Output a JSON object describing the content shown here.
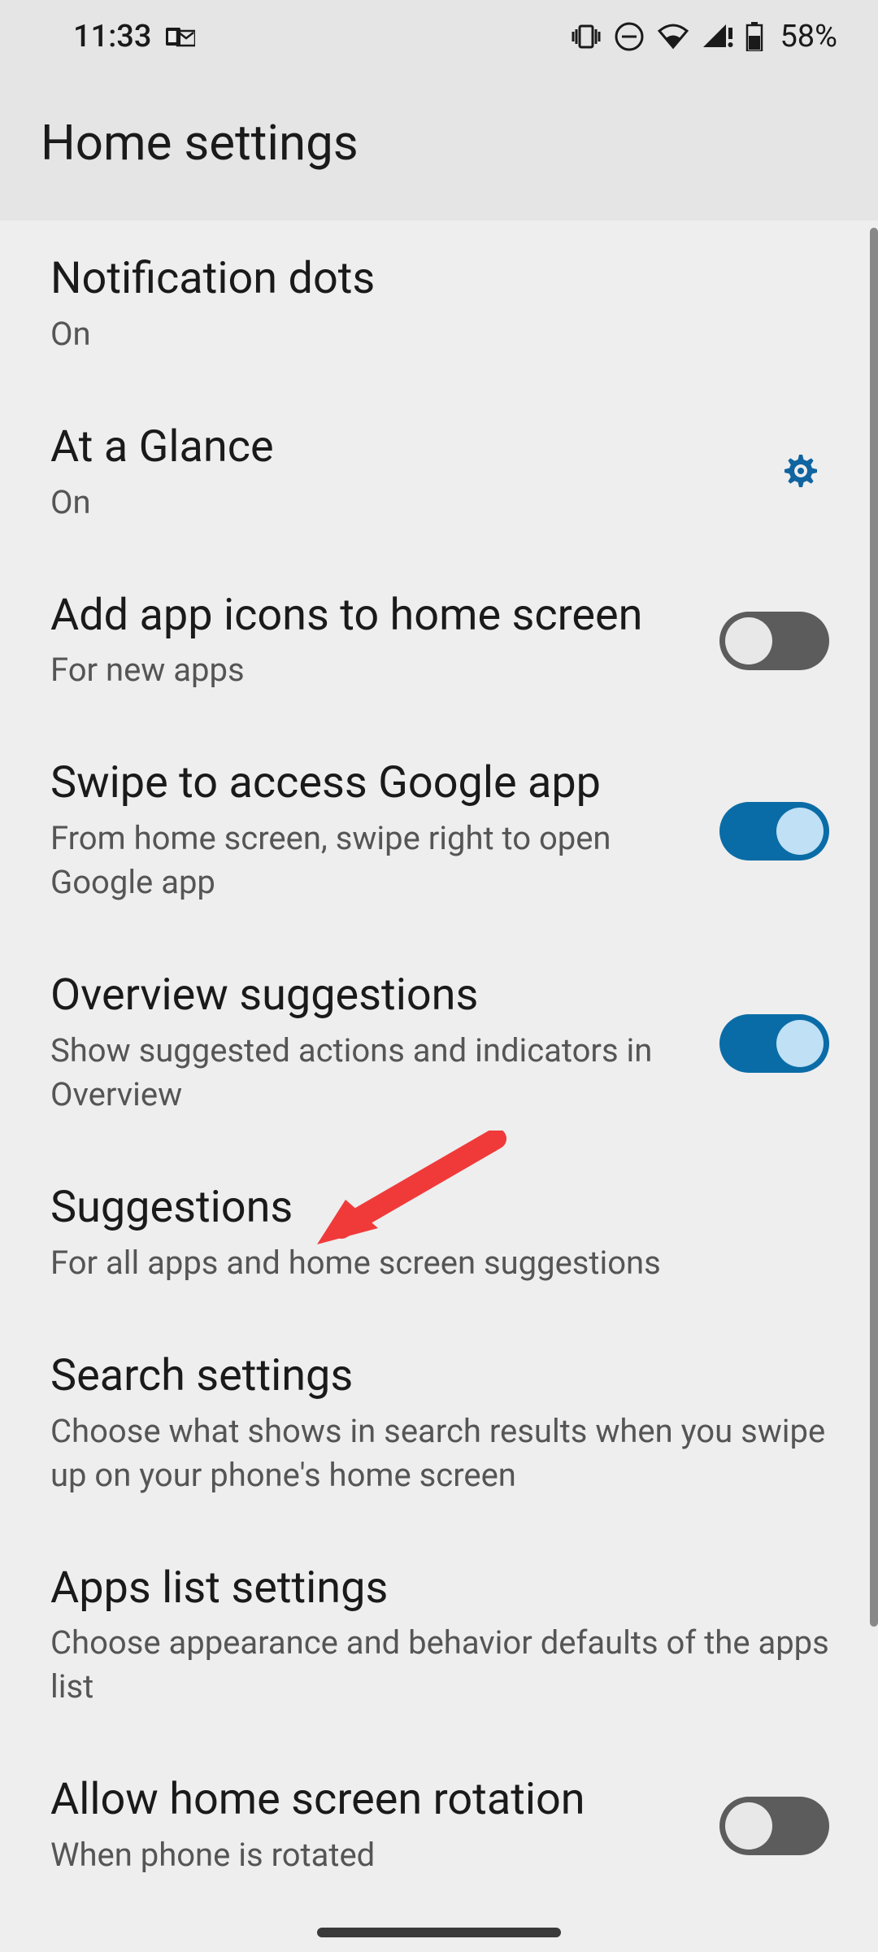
{
  "statusbar": {
    "time": "11:33",
    "battery": "58%",
    "icons": [
      "outlook-icon",
      "vibrate-icon",
      "dnd-icon",
      "wifi-icon",
      "signal-icon",
      "battery-icon"
    ]
  },
  "header": {
    "title": "Home settings"
  },
  "settings": {
    "notification_dots": {
      "title": "Notification dots",
      "subtitle": "On"
    },
    "at_a_glance": {
      "title": "At a Glance",
      "subtitle": "On"
    },
    "add_app_icons": {
      "title": "Add app icons to home screen",
      "subtitle": "For new apps",
      "toggle": false
    },
    "swipe_google": {
      "title": "Swipe to access Google app",
      "subtitle": "From home screen, swipe right to open Google app",
      "toggle": true
    },
    "overview_suggestions": {
      "title": "Overview suggestions",
      "subtitle": "Show suggested actions and indicators in Overview",
      "toggle": true
    },
    "suggestions": {
      "title": "Suggestions",
      "subtitle": "For all apps and home screen suggestions"
    },
    "search_settings": {
      "title": "Search settings",
      "subtitle": "Choose what shows in search results when you swipe up on your phone's home screen"
    },
    "apps_list": {
      "title": "Apps list settings",
      "subtitle": "Choose appearance and behavior defaults of the apps list"
    },
    "rotation": {
      "title": "Allow home screen rotation",
      "subtitle": "When phone is rotated",
      "toggle": false
    }
  },
  "colors": {
    "accent": "#0a6ca6",
    "gear": "#1064a0"
  }
}
